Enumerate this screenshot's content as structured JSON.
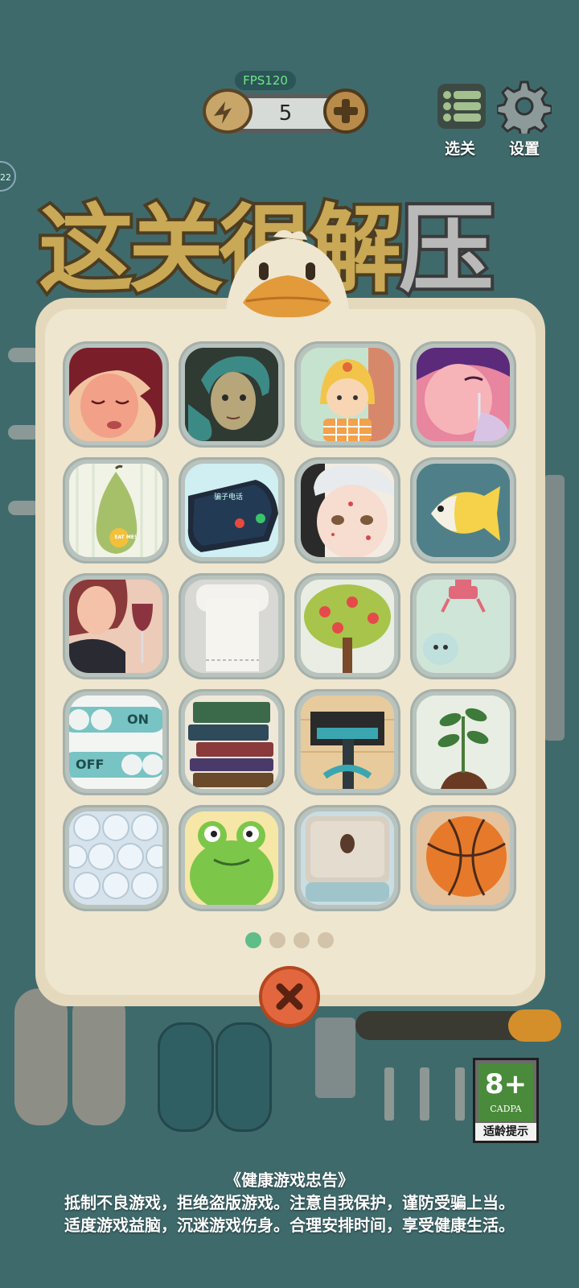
{
  "hud": {
    "fps": "FPS120",
    "energy": "5",
    "level_select_label": "选关",
    "settings_label": "设置",
    "side_tab": "22"
  },
  "title_art": {
    "text_main": "这关很解",
    "text_last": "压"
  },
  "levels": [
    {
      "name": "sad-girl"
    },
    {
      "name": "pearl-earring-portrait"
    },
    {
      "name": "doll-girl"
    },
    {
      "name": "crying-woman"
    },
    {
      "name": "pear"
    },
    {
      "name": "phone-call"
    },
    {
      "name": "acne-face"
    },
    {
      "name": "tropical-fish"
    },
    {
      "name": "woman-with-wine"
    },
    {
      "name": "toilet-paper"
    },
    {
      "name": "apple-tree"
    },
    {
      "name": "claw-machine"
    },
    {
      "name": "on-off-switches"
    },
    {
      "name": "book-stack"
    },
    {
      "name": "vacuum-cleaner"
    },
    {
      "name": "sprout"
    },
    {
      "name": "bubble-wrap"
    },
    {
      "name": "frog"
    },
    {
      "name": "litter-box"
    },
    {
      "name": "basketball"
    }
  ],
  "switch_tile": {
    "on": "ON",
    "off": "OFF"
  },
  "phone_tile": {
    "caller": "骗子电话"
  },
  "pear_tile": {
    "sticker": "EAT ME!"
  },
  "pagination": {
    "pages": 4,
    "current": 1
  },
  "age_rating": {
    "age": "8+",
    "org": "CADPA",
    "label": "适龄提示"
  },
  "health_advice": {
    "title": "《健康游戏忠告》",
    "line1": "抵制不良游戏，拒绝盗版游戏。注意自我保护，谨防受骗上当。",
    "line2": "适度游戏益脑，沉迷游戏伤身。合理安排时间，享受健康生活。"
  },
  "colors": {
    "accent_green": "#5fbd88",
    "close_red": "#e2673e",
    "panel": "#efe6d0",
    "background": "#3f6a6c"
  }
}
